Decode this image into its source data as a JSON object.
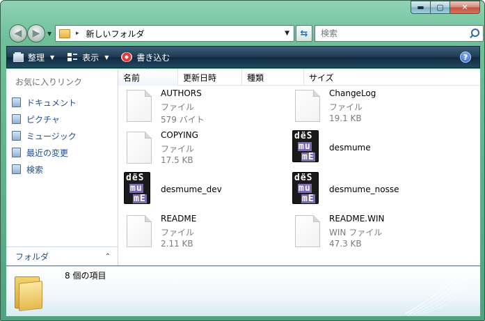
{
  "window": {
    "caption_buttons": [
      "▬",
      "▢",
      "✕"
    ]
  },
  "address_bar": {
    "path": "新しいフォルダ",
    "separator": "▸",
    "dropdown": "▼"
  },
  "search": {
    "placeholder": "検索"
  },
  "toolbar": {
    "organize_label": "整理",
    "views_label": "表示",
    "burn_label": "書き込む",
    "dropdown_glyph": "▼",
    "help_glyph": "?"
  },
  "nav_pane": {
    "heading": "お気に入りリンク",
    "items": [
      {
        "label": "ドキュメント"
      },
      {
        "label": "ピクチャ"
      },
      {
        "label": "ミュージック"
      },
      {
        "label": "最近の変更"
      },
      {
        "label": "検索"
      }
    ],
    "folders_label": "フォルダ",
    "folders_chevron": "⌃"
  },
  "columns": {
    "name": "名前",
    "modified": "更新日時",
    "type": "種類",
    "size": "サイズ"
  },
  "files": [
    {
      "name": "AUTHORS",
      "type": "ファイル",
      "size": "579 バイト",
      "icon": "document"
    },
    {
      "name": "ChangeLog",
      "type": "ファイル",
      "size": "19.1 KB",
      "icon": "document"
    },
    {
      "name": "COPYING",
      "type": "ファイル",
      "size": "17.5 KB",
      "icon": "document"
    },
    {
      "name": "desmume",
      "type": "",
      "size": "",
      "icon": "desmume-app"
    },
    {
      "name": "desmume_dev",
      "type": "",
      "size": "",
      "icon": "desmume-app"
    },
    {
      "name": "desmume_nosse",
      "type": "",
      "size": "",
      "icon": "desmume-app"
    },
    {
      "name": "README",
      "type": "ファイル",
      "size": "2.11 KB",
      "icon": "document"
    },
    {
      "name": "README.WIN",
      "type": "WIN ファイル",
      "size": "47.3 KB",
      "icon": "document"
    }
  ],
  "desmume_icon_rows": [
    "dëS",
    "mu",
    "mE"
  ],
  "details": {
    "item_count": "8 個の項目"
  },
  "colors": {
    "frame": "#6fbf98",
    "command_bar": "#1e3a52",
    "link": "#1f4e8c"
  }
}
